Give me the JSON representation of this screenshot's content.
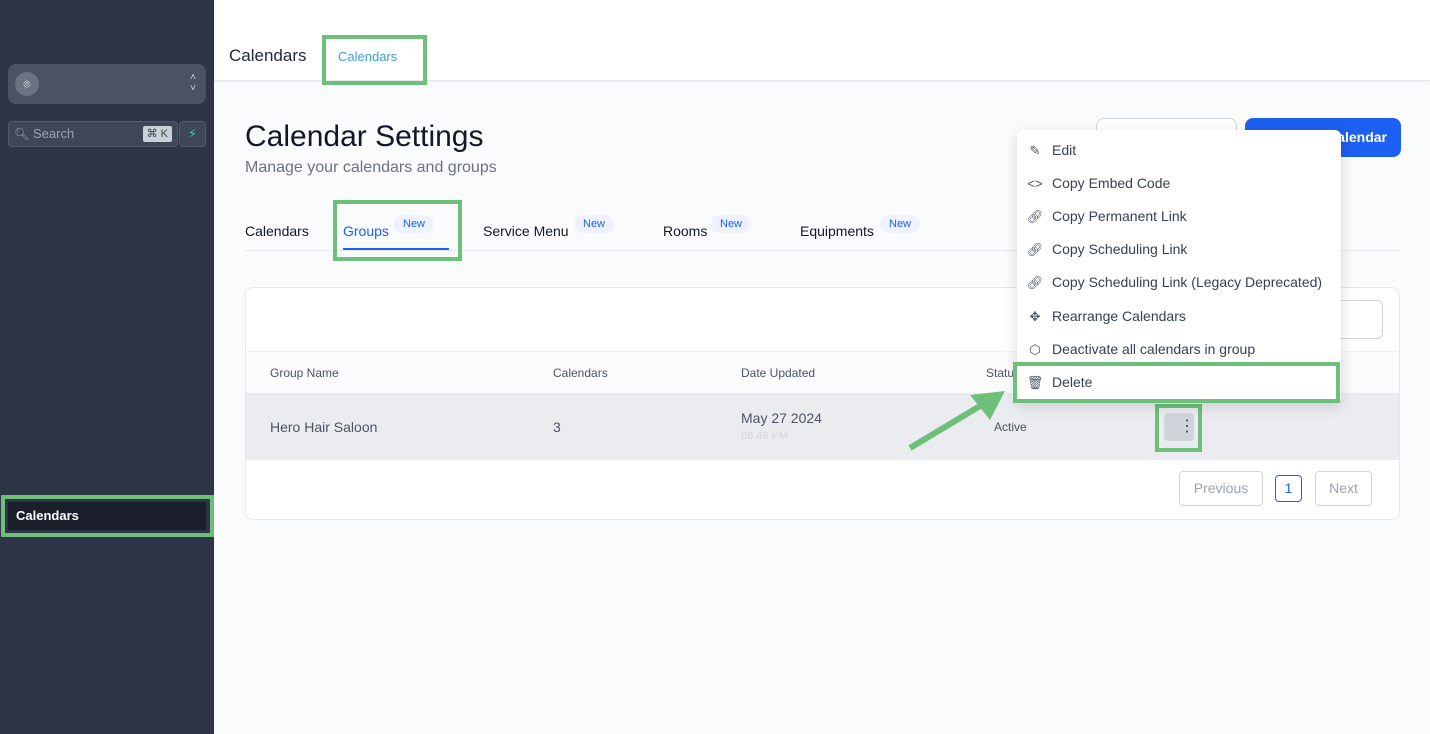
{
  "sidebar": {
    "search_placeholder": "Search",
    "shortcut": "⌘ K",
    "active_item": "Calendars"
  },
  "topbar": {
    "title": "Calendars",
    "tab": "Calendars"
  },
  "page": {
    "title": "Calendar Settings",
    "subtitle": "Manage your calendars and groups",
    "primary_button": "alendar"
  },
  "tabs": [
    {
      "label": "Calendars"
    },
    {
      "label": "Groups",
      "badge": "New"
    },
    {
      "label": "Service Menu",
      "badge": "New"
    },
    {
      "label": "Rooms",
      "badge": "New"
    },
    {
      "label": "Equipments",
      "badge": "New"
    }
  ],
  "table": {
    "headers": [
      "Group Name",
      "Calendars",
      "Date Updated",
      "Statu"
    ],
    "rows": [
      {
        "name": "Hero Hair Saloon",
        "calendars": "3",
        "date": "May 27 2024",
        "time": "08 46 PM",
        "status": "Active"
      }
    ]
  },
  "pagination": {
    "previous": "Previous",
    "page": "1",
    "next": "Next"
  },
  "menu": [
    {
      "label": "Edit",
      "icon": "pencil-icon"
    },
    {
      "label": "Copy Embed Code",
      "icon": "code-icon"
    },
    {
      "label": "Copy Permanent Link",
      "icon": "link-icon"
    },
    {
      "label": "Copy Scheduling Link",
      "icon": "link-icon"
    },
    {
      "label": "Copy Scheduling Link (Legacy Deprecated)",
      "icon": "link-icon"
    },
    {
      "label": "Rearrange Calendars",
      "icon": "move-icon"
    },
    {
      "label": "Deactivate all calendars in group",
      "icon": "hexagon-icon"
    },
    {
      "label": "Delete",
      "icon": "trash-icon"
    }
  ],
  "colors": {
    "accent": "#1d5ff0",
    "highlight": "#6dbf7a",
    "sidebar": "#2d3546"
  }
}
